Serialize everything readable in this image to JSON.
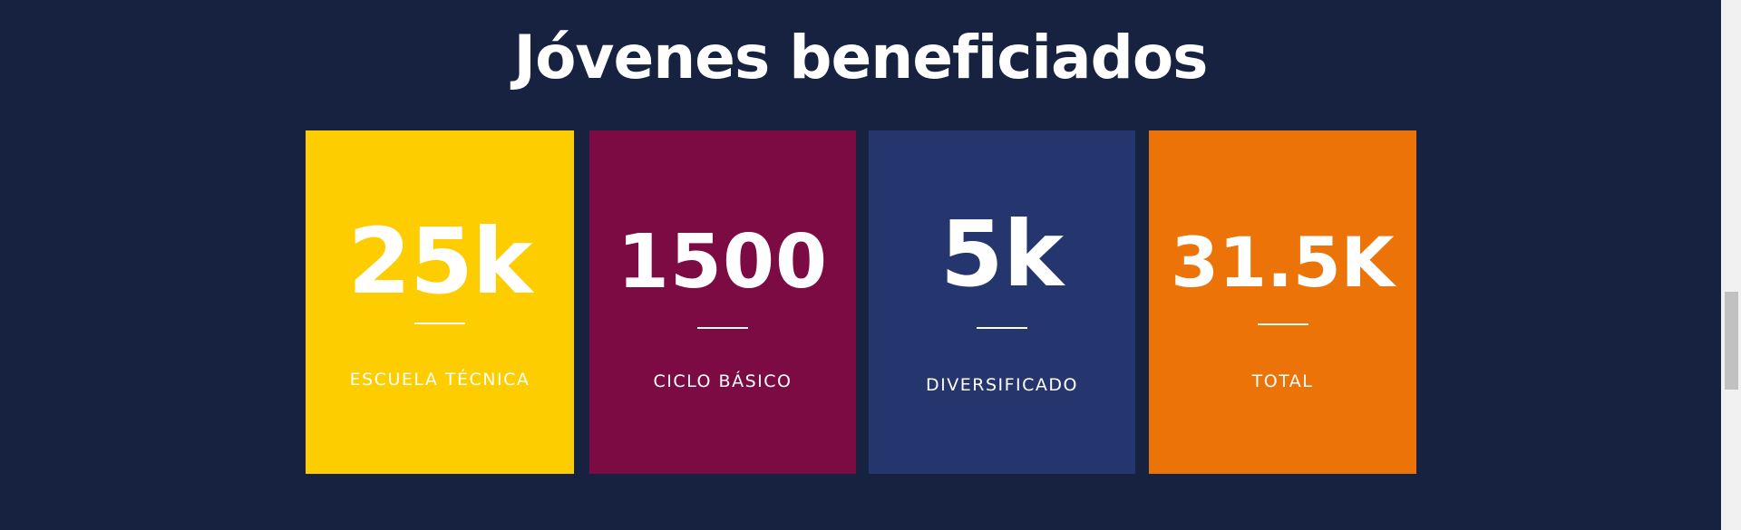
{
  "section": {
    "title": "Jóvenes beneficiados"
  },
  "stats": [
    {
      "value": "25k",
      "label": "ESCUELA TÉCNICA",
      "color": "#fdcd00"
    },
    {
      "value": "1500",
      "label": "CICLO BÁSICO",
      "color": "#7c0b43"
    },
    {
      "value": "5k",
      "label": "DIVERSIFICADO",
      "color": "#25366e"
    },
    {
      "value": "31.5K",
      "label": "TOTAL",
      "color": "#eb7308"
    }
  ],
  "colors": {
    "background": "#162240",
    "text": "#ffffff",
    "scrollbar_track": "#f1f1f1",
    "scrollbar_thumb": "#c1c1c1"
  }
}
